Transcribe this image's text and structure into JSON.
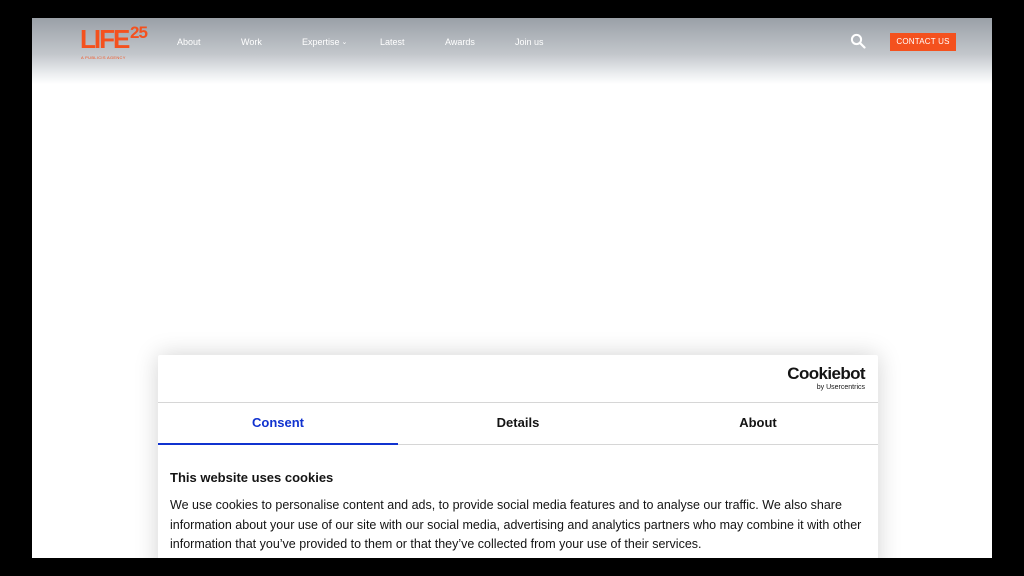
{
  "header": {
    "logo": {
      "main": "LIFE",
      "number": "25",
      "tagline": "A PUBLICIS AGENCY"
    },
    "nav": [
      {
        "label": "About"
      },
      {
        "label": "Work"
      },
      {
        "label": "Expertise",
        "has_dropdown": true
      },
      {
        "label": "Latest"
      },
      {
        "label": "Awards"
      },
      {
        "label": "Join us"
      }
    ],
    "search_icon": "search-icon",
    "contact_label": "CONTACT US"
  },
  "cookie_banner": {
    "brand": {
      "name": "Cookiebot",
      "by": "by Usercentrics"
    },
    "tabs": [
      {
        "label": "Consent",
        "active": true
      },
      {
        "label": "Details",
        "active": false
      },
      {
        "label": "About",
        "active": false
      }
    ],
    "title": "This website uses cookies",
    "body": "We use cookies to personalise content and ads, to provide social media features and to analyse our traffic. We also share information about your use of our site with our social media, advertising and analytics partners who may combine it with other information that you’ve provided to them or that they’ve collected from your use of their services."
  },
  "colors": {
    "accent": "#f4511e",
    "consent_active": "#1032cf",
    "text": "#141414"
  }
}
